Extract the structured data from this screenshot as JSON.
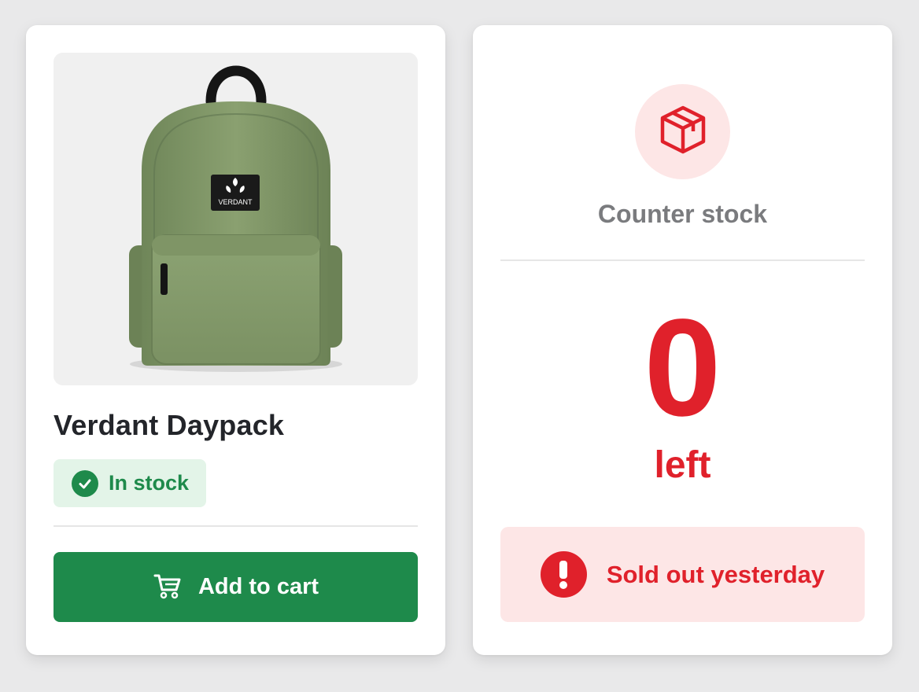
{
  "product": {
    "brand_patch": "VERDANT",
    "title": "Verdant Daypack",
    "availability": "In stock",
    "add_to_cart_label": "Add to cart",
    "colors": {
      "accent": "#1e8a4b",
      "pill_bg": "#e3f4e8",
      "bag": "#849b6c"
    },
    "icons": {
      "availability": "check-circle-icon",
      "cart": "cart-icon"
    }
  },
  "stock": {
    "heading": "Counter stock",
    "count": "0",
    "unit": "left",
    "alert": "Sold out yesterday",
    "colors": {
      "accent": "#e0212b",
      "soft_bg": "#fde6e6"
    },
    "icons": {
      "header": "box-icon",
      "alert": "exclamation-circle-icon"
    }
  }
}
